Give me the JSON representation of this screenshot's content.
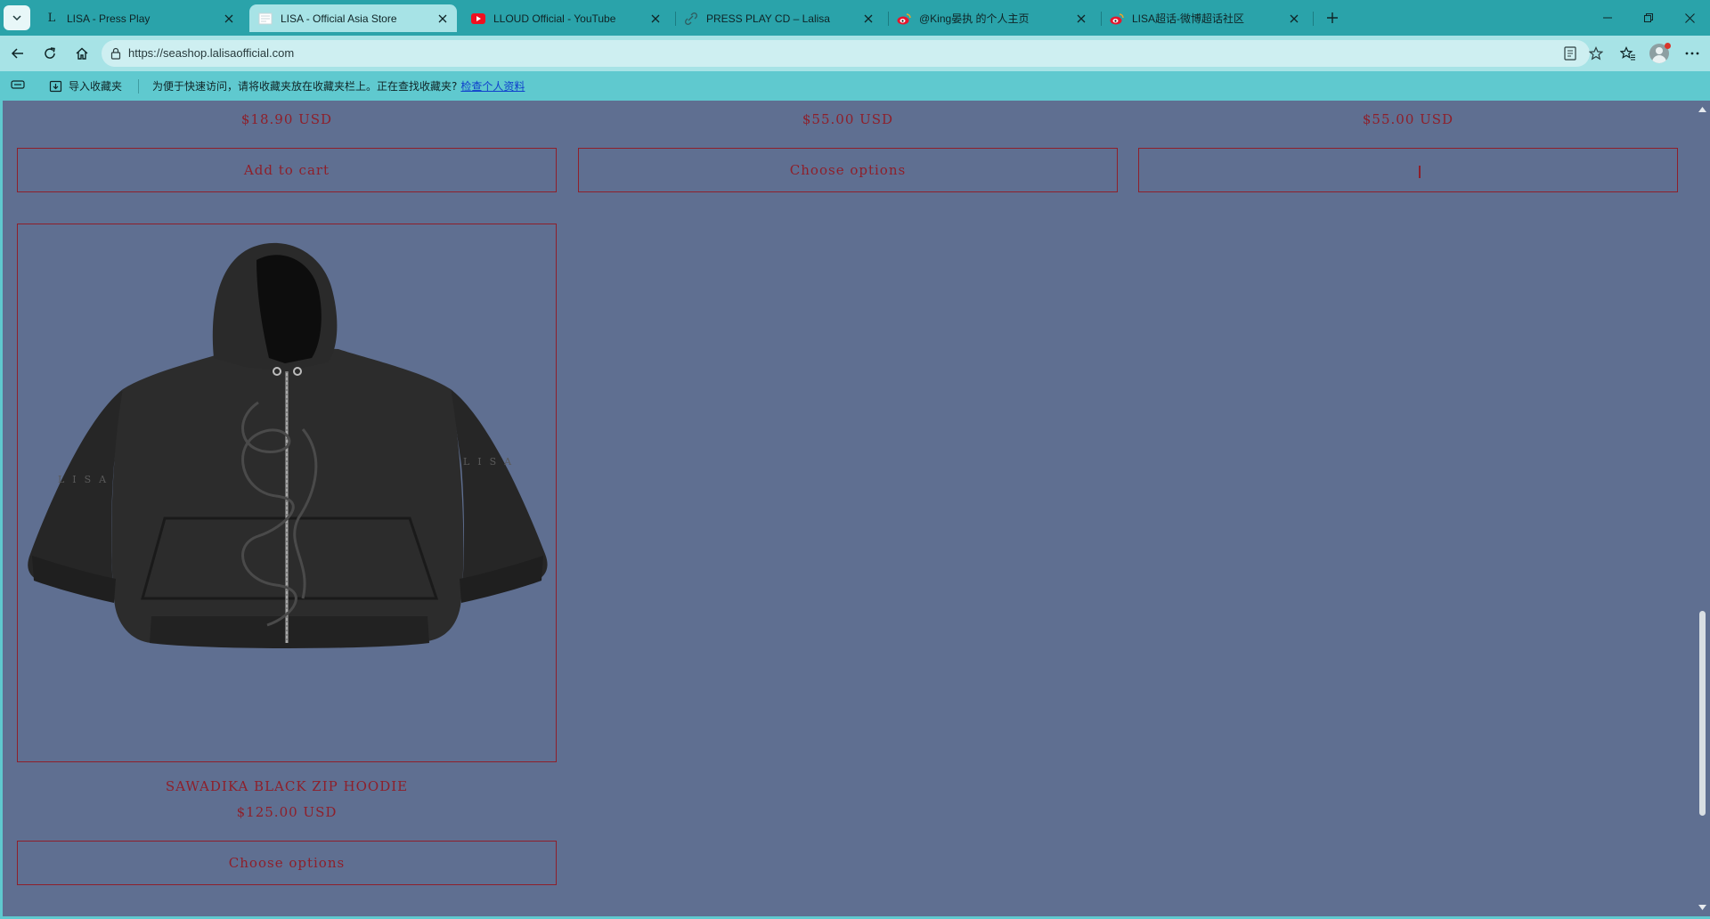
{
  "browser": {
    "tabs": [
      {
        "title": "LISA - Press Play",
        "favicon": "letter-l-icon",
        "active": false
      },
      {
        "title": "LISA - Official Asia Store",
        "favicon": "store-page-icon",
        "active": true
      },
      {
        "title": "LLOUD Official - YouTube",
        "favicon": "youtube-icon",
        "active": false
      },
      {
        "title": "PRESS PLAY CD – Lalisa",
        "favicon": "link-icon",
        "active": false
      },
      {
        "title": "@King晏执 的个人主页",
        "favicon": "weibo-icon",
        "active": false
      },
      {
        "title": "LISA超话-微博超话社区",
        "favicon": "weibo-icon",
        "active": false
      }
    ],
    "url": "https://seashop.lalisaofficial.com",
    "favorites_bar": {
      "import_label": "导入收藏夹",
      "hint": "为便于快速访问，请将收藏夹放在收藏夹栏上。正在查找收藏夹?",
      "link": "检查个人资料"
    }
  },
  "page": {
    "top_row": [
      {
        "price": "$18.90 USD",
        "button": "Add to cart"
      },
      {
        "price": "$55.00 USD",
        "button": "Choose options"
      },
      {
        "price": "$55.00 USD",
        "button": ""
      }
    ],
    "product": {
      "name": "SAWADIKA BLACK ZIP HOODIE",
      "price": "$125.00 USD",
      "button": "Choose options",
      "image_icon": "black-zip-hoodie-image"
    }
  },
  "colors": {
    "page_bg": "#5f6f91",
    "accent": "#8e1f2a",
    "browser_chrome": "#5fc9cf",
    "tabstrip": "#2aa3aa"
  }
}
